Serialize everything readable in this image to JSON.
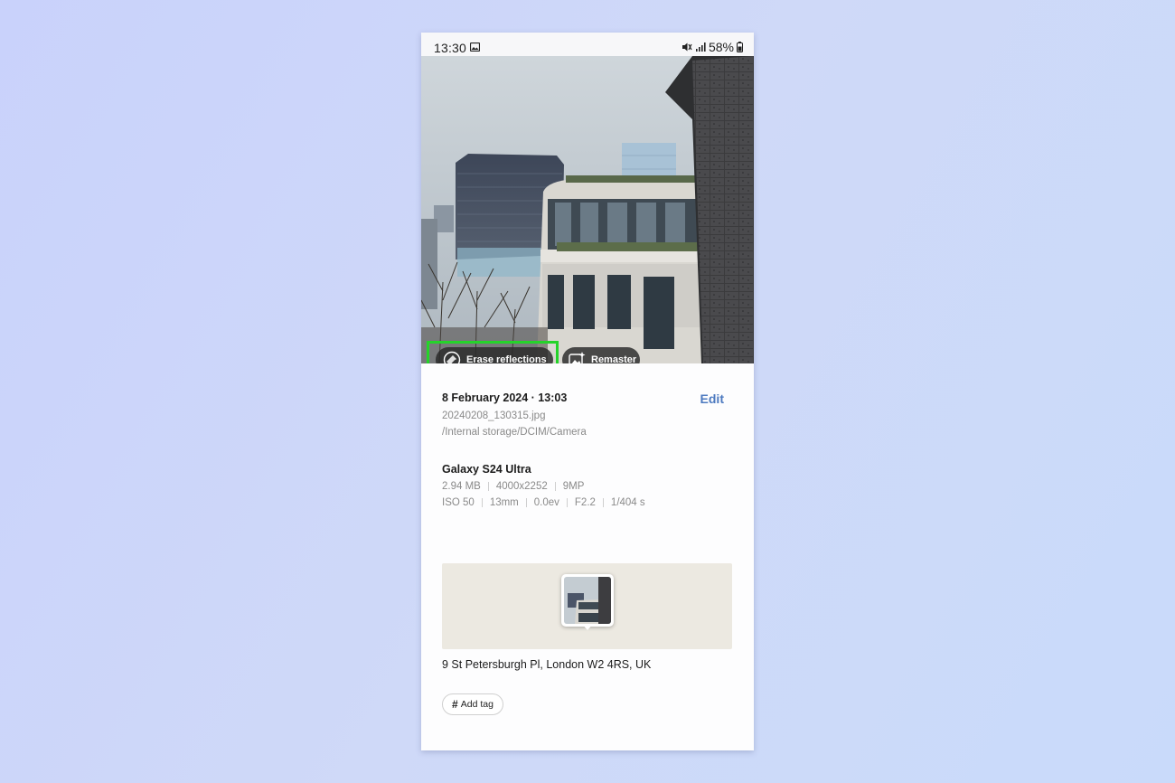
{
  "status_bar": {
    "time": "13:30",
    "battery": "58%",
    "icons": [
      "gallery-icon",
      "mute-icon",
      "signal-icon",
      "battery-icon"
    ]
  },
  "photo_actions": {
    "erase_label": "Erase reflections",
    "erase_icon": "erase-reflections-icon",
    "remaster_label": "Remaster",
    "remaster_icon": "remaster-icon",
    "highlight_color": "#25d32a"
  },
  "details": {
    "date_time": "8 February 2024 · 13:03",
    "edit_label": "Edit",
    "filename": "20240208_130315.jpg",
    "path": "/Internal storage/DCIM/Camera",
    "device": "Galaxy S24 Ultra",
    "file_info": [
      "2.94 MB",
      "4000x2252",
      "9MP"
    ],
    "camera_info": [
      "ISO 50",
      "13mm",
      "0.0ev",
      "F2.2",
      "1/404 s"
    ],
    "address": "9 St Petersburgh Pl, London W2 4RS, UK",
    "add_tag_label": "Add tag",
    "add_tag_icon": "hash-icon"
  },
  "colors": {
    "accent": "#4d7ac0",
    "background": "#c9d2fb",
    "map_background": "#ece9e1"
  }
}
